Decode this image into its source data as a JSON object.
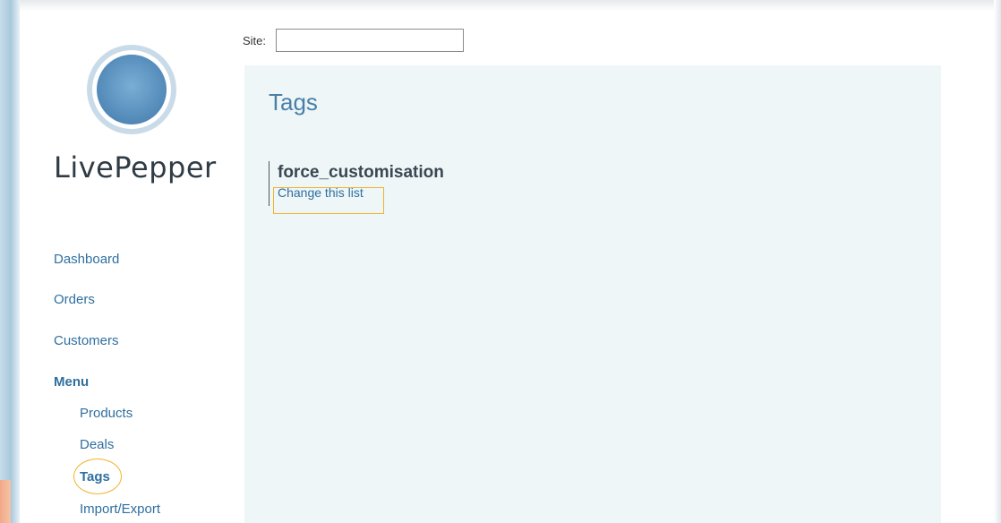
{
  "brand": {
    "name": "LivePepper",
    "logo_icon": "circle-logo-icon",
    "logo_color": "#5d93bf"
  },
  "site": {
    "label": "Site:",
    "value": ""
  },
  "sidebar": {
    "items": [
      {
        "label": "Dashboard"
      },
      {
        "label": "Orders"
      },
      {
        "label": "Customers"
      },
      {
        "label": "Menu"
      }
    ],
    "sub_items": [
      {
        "label": "Products"
      },
      {
        "label": "Deals"
      },
      {
        "label": "Tags"
      },
      {
        "label": "Import/Export"
      }
    ],
    "highlight_color": "#f0b429",
    "link_color": "#2f6fa0"
  },
  "main": {
    "title": "Tags",
    "tags": [
      {
        "name": "force_customisation",
        "action_label": "Change this list"
      }
    ],
    "panel_color": "#eef6f8"
  }
}
